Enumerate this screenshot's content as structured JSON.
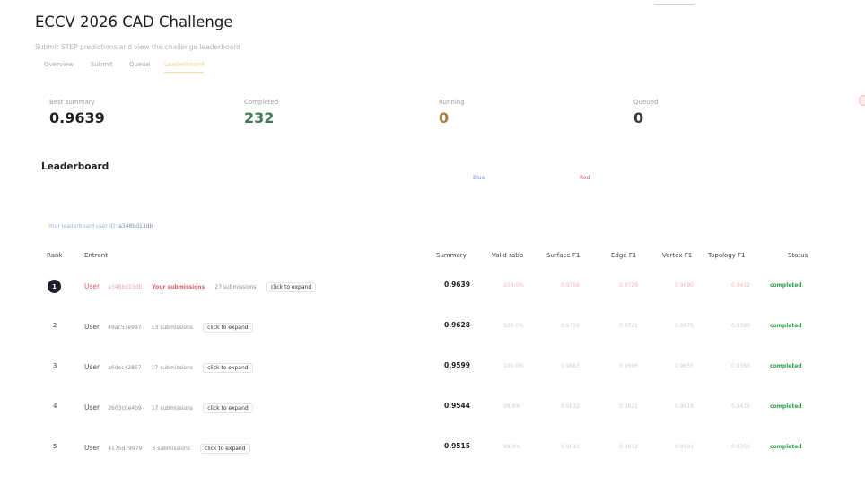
{
  "header": {
    "title": "ECCV 2026 CAD Challenge",
    "subtitle": "Submit STEP predictions and view the challenge leaderboard"
  },
  "tabs": [
    {
      "label": "Overview",
      "active": false
    },
    {
      "label": "Submit",
      "active": false
    },
    {
      "label": "Queue",
      "active": false
    },
    {
      "label": "Leaderboard",
      "active": true
    }
  ],
  "stats": [
    {
      "label": "Best summary",
      "value": "0.9639",
      "color": "#1f1f1f"
    },
    {
      "label": "Completed",
      "value": "232",
      "color": "#3d7a52"
    },
    {
      "label": "Running",
      "value": "0",
      "color": "#a97b3c"
    },
    {
      "label": "Queued",
      "value": "0",
      "color": "#3a3a3a"
    }
  ],
  "leaderboard": {
    "title": "Leaderboard",
    "highlight_blue": "Blue",
    "highlight_red": "Red",
    "your_id_label": "Your leaderboard user ID:",
    "your_id_value": "a348bd13db"
  },
  "columns": {
    "rank": "Rank",
    "entrant": "Entrant",
    "summary": "Summary",
    "valid_ratio": "Valid ratio",
    "surface_f1": "Surface F1",
    "edge_f1": "Edge F1",
    "vertex_f1": "Vertex F1",
    "topology_f1": "Topology F1",
    "status": "Status"
  },
  "rows": [
    {
      "rank": "1",
      "user": "User",
      "id": "a348bd13db",
      "is_me": true,
      "your_submissions": "Your submissions",
      "submissions": "27 submissions",
      "expand": "click to expand",
      "summary": "0.9639",
      "valid_ratio": "100.0%",
      "surface_f1": "0.9756",
      "edge_f1": "0.9729",
      "vertex_f1": "0.9690",
      "topology_f1": "0.9412",
      "status": "completed"
    },
    {
      "rank": "2",
      "user": "User",
      "id": "49ac53e997",
      "is_me": false,
      "submissions": "13 submissions",
      "expand": "click to expand",
      "summary": "0.9628",
      "valid_ratio": "100.0%",
      "surface_f1": "0.9726",
      "edge_f1": "0.9721",
      "vertex_f1": "0.9675",
      "topology_f1": "0.9390",
      "status": "completed"
    },
    {
      "rank": "3",
      "user": "User",
      "id": "a6dec42857",
      "is_me": false,
      "submissions": "17 submissions",
      "expand": "click to expand",
      "summary": "0.9599",
      "valid_ratio": "100.0%",
      "surface_f1": "0.9683",
      "edge_f1": "0.9696",
      "vertex_f1": "0.9655",
      "topology_f1": "0.9366",
      "status": "completed"
    },
    {
      "rank": "4",
      "user": "User",
      "id": "2603c0e4b9",
      "is_me": false,
      "submissions": "17 submissions",
      "expand": "click to expand",
      "summary": "0.9544",
      "valid_ratio": "99.9%",
      "surface_f1": "0.9632",
      "edge_f1": "0.9621",
      "vertex_f1": "0.9618",
      "topology_f1": "0.9416",
      "status": "completed"
    },
    {
      "rank": "5",
      "user": "User",
      "id": "4175d79979",
      "is_me": false,
      "submissions": "5 submissions",
      "expand": "click to expand",
      "summary": "0.9515",
      "valid_ratio": "99.9%",
      "surface_f1": "0.9611",
      "edge_f1": "0.9612",
      "vertex_f1": "0.9591",
      "topology_f1": "0.9350",
      "status": "completed"
    }
  ]
}
